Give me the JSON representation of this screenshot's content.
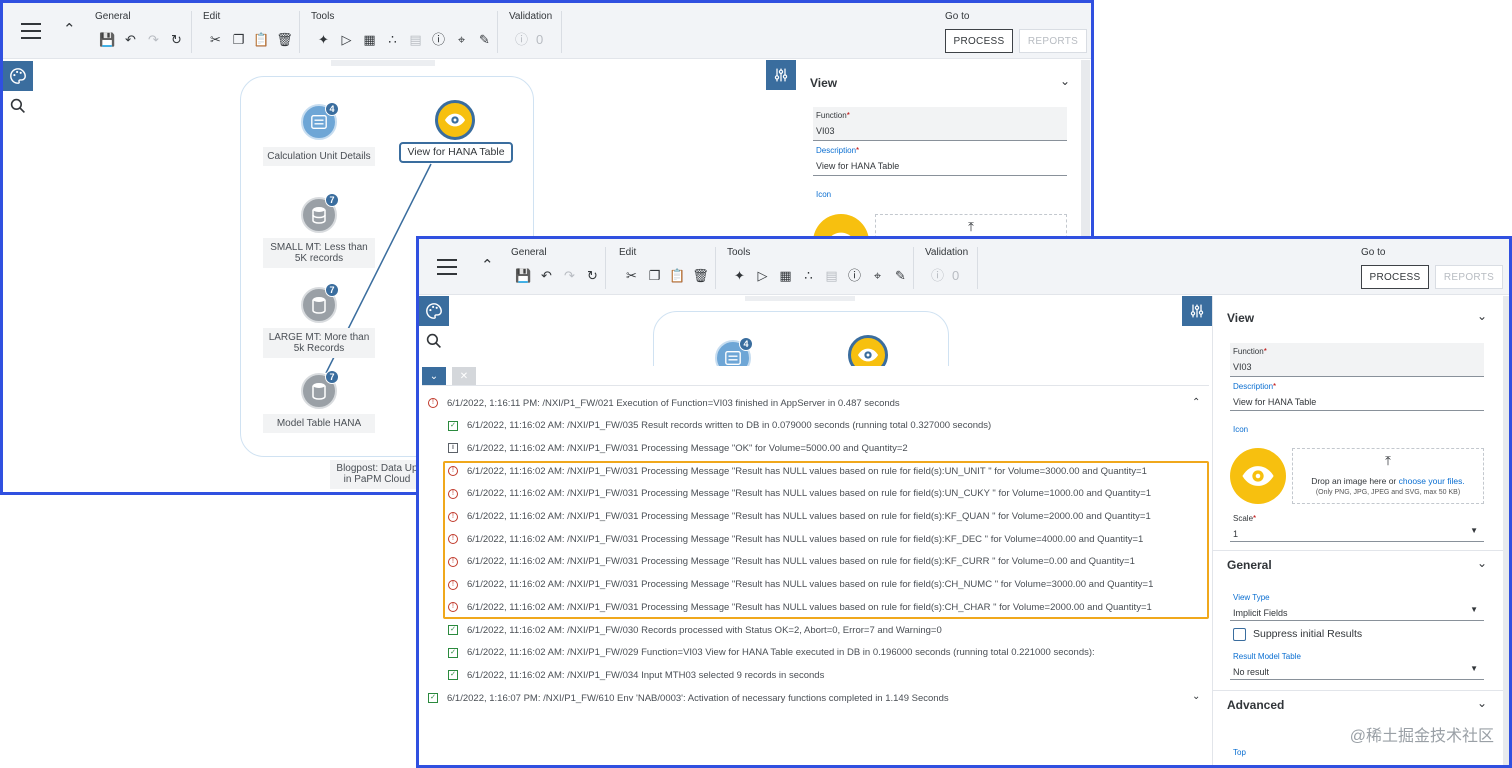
{
  "toolbar": {
    "groups": {
      "general": "General",
      "edit": "Edit",
      "tools": "Tools",
      "validation": "Validation",
      "validation_count": "0"
    },
    "goto": "Go to",
    "process_button": "PROCESS",
    "reports_button": "REPORTS"
  },
  "diagram": {
    "nodes": [
      {
        "label": "Calculation Unit Details",
        "badge": "4"
      },
      {
        "label": "SMALL MT: Less than 5K records",
        "badge": "7"
      },
      {
        "label": "LARGE MT: More than 5k Records",
        "badge": "7"
      },
      {
        "label": "Model Table HANA",
        "badge": "7"
      },
      {
        "label": "View for HANA Table"
      }
    ],
    "caption": "Blogpost: Data Up... in PaPM Cloud",
    "caption_line1": "Blogpost: Data Up",
    "caption_line2": "in PaPM Cloud"
  },
  "properties": {
    "view_title": "View",
    "function_label": "Function",
    "function_value": "VI03",
    "description_label": "Description",
    "description_value": "View for HANA Table",
    "icon_label": "Icon",
    "dropzone_text": "Drop an image here or ",
    "dropzone_link": "choose your files.",
    "dropzone_hint": "(Only PNG, JPG, JPEG and SVG, max 50 KB)",
    "scale_label": "Scale",
    "scale_value": "1",
    "general_title": "General",
    "view_type_label": "View Type",
    "view_type_value": "Implicit Fields",
    "suppress_label": "Suppress initial Results",
    "result_model_label": "Result Model Table",
    "result_model_value": "No result",
    "advanced_title": "Advanced",
    "top_label": "Top"
  },
  "log": [
    {
      "type": "err",
      "text": "6/1/2022, 1:16:11 PM: /NXI/P1_FW/021 Execution of Function=VI03 finished in AppServer in 0.487 seconds"
    },
    {
      "type": "ok",
      "text": "6/1/2022, 11:16:02 AM: /NXI/P1_FW/035 Result records written to DB in 0.079000 seconds (running total 0.327000 seconds)"
    },
    {
      "type": "info",
      "text": "6/1/2022, 11:16:02 AM: /NXI/P1_FW/031 Processing Message \"OK\" for Volume=5000.00 and Quantity=2"
    },
    {
      "type": "err",
      "text": "6/1/2022, 11:16:02 AM: /NXI/P1_FW/031 Processing Message \"Result has NULL values based on rule for field(s):UN_UNIT \" for Volume=3000.00 and Quantity=1"
    },
    {
      "type": "err",
      "text": "6/1/2022, 11:16:02 AM: /NXI/P1_FW/031 Processing Message \"Result has NULL values based on rule for field(s):UN_CUKY \" for Volume=1000.00 and Quantity=1"
    },
    {
      "type": "err",
      "text": "6/1/2022, 11:16:02 AM: /NXI/P1_FW/031 Processing Message \"Result has NULL values based on rule for field(s):KF_QUAN \" for Volume=2000.00 and Quantity=1"
    },
    {
      "type": "err",
      "text": "6/1/2022, 11:16:02 AM: /NXI/P1_FW/031 Processing Message \"Result has NULL values based on rule for field(s):KF_DEC \" for Volume=4000.00 and Quantity=1"
    },
    {
      "type": "err",
      "text": "6/1/2022, 11:16:02 AM: /NXI/P1_FW/031 Processing Message \"Result has NULL values based on rule for field(s):KF_CURR \" for Volume=0.00 and Quantity=1"
    },
    {
      "type": "err",
      "text": "6/1/2022, 11:16:02 AM: /NXI/P1_FW/031 Processing Message \"Result has NULL values based on rule for field(s):CH_NUMC \" for Volume=3000.00 and Quantity=1"
    },
    {
      "type": "err",
      "text": "6/1/2022, 11:16:02 AM: /NXI/P1_FW/031 Processing Message \"Result has NULL values based on rule for field(s):CH_CHAR \" for Volume=2000.00 and Quantity=1"
    },
    {
      "type": "ok",
      "text": "6/1/2022, 11:16:02 AM: /NXI/P1_FW/030 Records processed with Status OK=2, Abort=0, Error=7 and Warning=0"
    },
    {
      "type": "ok",
      "text": "6/1/2022, 11:16:02 AM: /NXI/P1_FW/029 Function=VI03 View for HANA Table executed in DB in 0.196000 seconds (running total 0.221000 seconds):"
    },
    {
      "type": "ok",
      "text": "6/1/2022, 11:16:02 AM: /NXI/P1_FW/034 Input MTH03 selected 9 records in seconds"
    },
    {
      "type": "ok",
      "text": "6/1/2022, 1:16:07 PM: /NXI/P1_FW/610 Env 'NAB/0003': Activation of necessary functions completed in 1.149 Seconds"
    }
  ],
  "watermark": "@稀土掘金技术社区",
  "colors": {
    "accent": "#3a6d9e",
    "frame": "#3050e0",
    "highlight": "#f0a81c",
    "eye": "#f7c00f"
  }
}
